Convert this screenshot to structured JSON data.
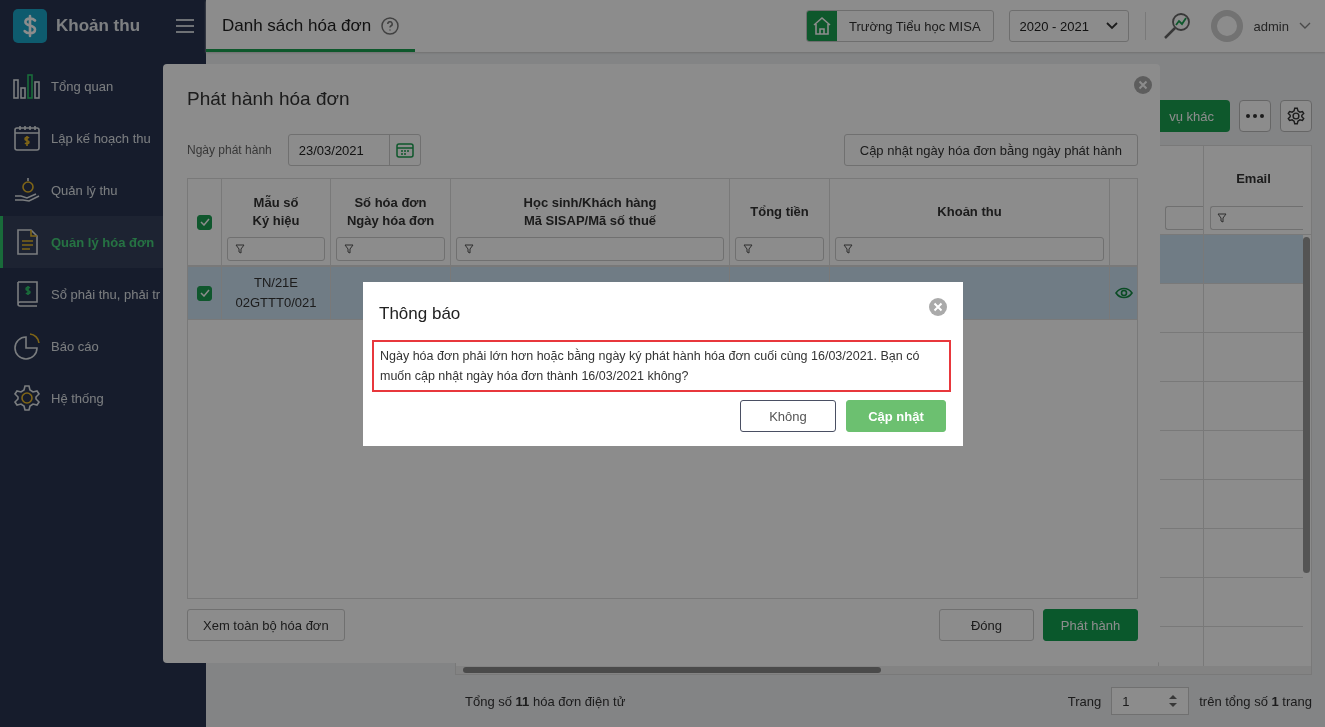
{
  "sidebar": {
    "app_title": "Khoản thu",
    "items": [
      {
        "label": "Tổng quan",
        "kind": "overview",
        "selected": false
      },
      {
        "label": "Lập kế hoạch thu",
        "kind": "plan",
        "selected": false
      },
      {
        "label": "Quản lý thu",
        "kind": "collect",
        "selected": false
      },
      {
        "label": "Quản lý hóa đơn",
        "kind": "invoice",
        "selected": true
      },
      {
        "label": "Sổ phải thu, phải tr",
        "kind": "ledger",
        "selected": false
      },
      {
        "label": "Báo cáo",
        "kind": "report",
        "selected": false
      },
      {
        "label": "Hệ thống",
        "kind": "system",
        "selected": false
      }
    ]
  },
  "header": {
    "tab": "Danh sách hóa đơn",
    "school": "Trường Tiểu học MISA",
    "year": "2020 - 2021",
    "user": "admin"
  },
  "page": {
    "toolbar_button": "vụ khác",
    "table": {
      "columns": [
        {
          "header": "Email"
        }
      ],
      "rows": [
        {
          "selected": true
        },
        {
          "selected": false
        },
        {
          "selected": false
        },
        {
          "selected": false
        },
        {
          "selected": false
        },
        {
          "selected": false
        },
        {
          "selected": false
        },
        {
          "selected": false
        },
        {
          "selected": false
        }
      ]
    },
    "footer": {
      "total": "Tổng số **11** hóa đơn điện tử",
      "page_label": "Trang",
      "page_value": "1",
      "page_total": "trên tổng số **1** trang"
    }
  },
  "modal": {
    "title": "Phát hành hóa đơn",
    "date_label": "Ngày phát hành",
    "date_value": "23/03/2021",
    "update_button": "Cập nhật ngày hóa đơn bằng ngày phát hành",
    "table": {
      "header_checked": true,
      "columns": [
        {
          "header": "Mẫu số\nKý hiệu"
        },
        {
          "header": "Số hóa đơn\nNgày hóa đơn"
        },
        {
          "header": "Học sinh/Khách hàng\nMã SISAP/Mã số thuế"
        },
        {
          "header": "Tổng tiền"
        },
        {
          "header": "Khoản thu"
        }
      ],
      "rows": [
        {
          "checked": true,
          "selected": true,
          "cells": [
            "TN/21E\n02GTTT0/021"
          ]
        }
      ]
    },
    "view_all_button": "Xem toàn bộ hóa đơn",
    "close_button": "Đóng",
    "issue_button": "Phát hành"
  },
  "notice": {
    "title": "Thông báo",
    "message": "Ngày hóa đơn phải lớn hơn hoặc bằng ngày ký phát hành hóa đơn cuối cùng 16/03/2021. Bạn có muốn cập nhật ngày hóa đơn thành 16/03/2021 không?",
    "buttons": [
      {
        "label": "Không",
        "kind": "secondary"
      },
      {
        "label": "Cập nhật",
        "kind": "primary"
      }
    ]
  }
}
